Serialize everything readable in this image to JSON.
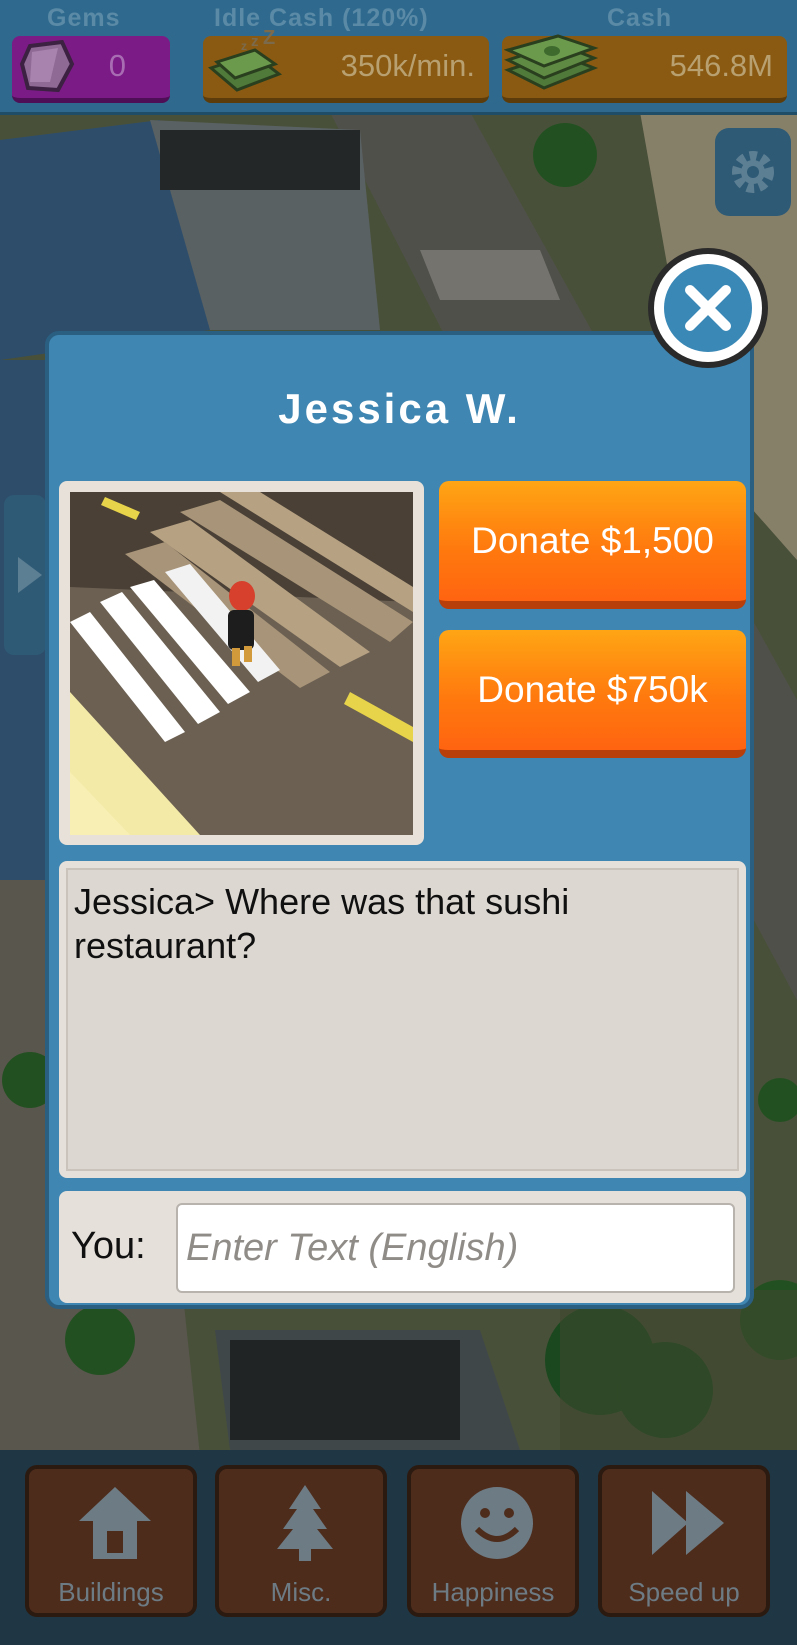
{
  "hud": {
    "gems_label": "Gems",
    "gems_value": "0",
    "idle_label": "Idle Cash (120%)",
    "idle_value": "350k/min.",
    "cash_label": "Cash",
    "cash_value": "546.8M"
  },
  "dialog": {
    "title": "Jessica W.",
    "donate_small": "Donate $1,500",
    "donate_large": "Donate $750k",
    "chat_line": "Jessica> Where was that sushi restaurant?",
    "you_label": "You:",
    "input_placeholder": "Enter Text (English)",
    "input_value": ""
  },
  "bottom_tabs": [
    {
      "label": "Buildings",
      "icon": "house-icon"
    },
    {
      "label": "Misc.",
      "icon": "tree-icon"
    },
    {
      "label": "Happiness",
      "icon": "smiley-icon"
    },
    {
      "label": "Speed up",
      "icon": "fast-forward-icon"
    }
  ],
  "colors": {
    "dialog_bg": "#3f86b2",
    "donate_orange": "#ff7a0e",
    "hud_blue": "#2f6a8e",
    "gem_purple": "#7b1b86",
    "cash_gold": "#8a5a12"
  }
}
